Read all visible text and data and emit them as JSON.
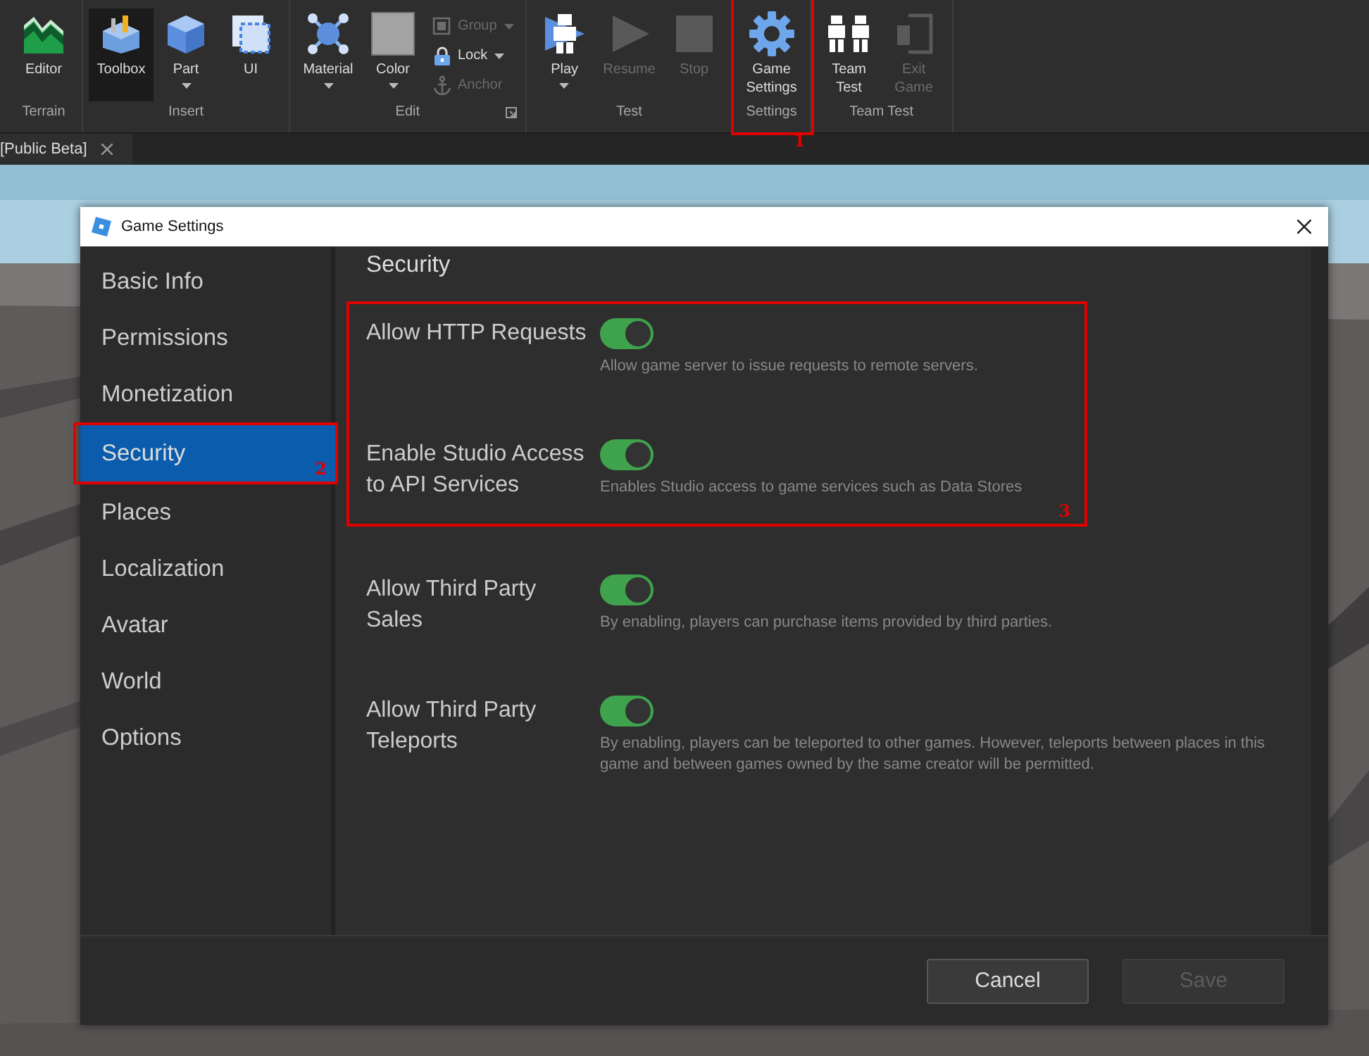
{
  "ribbon": {
    "groups": [
      {
        "label": "Terrain",
        "buttons": [
          {
            "kind": "large",
            "label": "Editor",
            "caret": false,
            "disabled": false,
            "selected": false
          }
        ]
      },
      {
        "label": "Insert",
        "buttons": [
          {
            "kind": "large",
            "label": "Toolbox",
            "caret": false,
            "disabled": false,
            "selected": true
          },
          {
            "kind": "large",
            "label": "Part",
            "caret": true,
            "disabled": false,
            "selected": false
          },
          {
            "kind": "large",
            "label": "UI",
            "caret": false,
            "disabled": false,
            "selected": false
          }
        ]
      },
      {
        "label": "Edit",
        "expander": true,
        "buttons": [
          {
            "kind": "large",
            "label": "Material",
            "caret": true,
            "disabled": false,
            "selected": false
          },
          {
            "kind": "large",
            "label": "Color",
            "caret": true,
            "disabled": false,
            "selected": false
          },
          {
            "kind": "small",
            "label": "Group",
            "caret": true,
            "disabled": true,
            "selected": false
          },
          {
            "kind": "small",
            "label": "Lock",
            "caret": true,
            "disabled": false,
            "selected": false
          },
          {
            "kind": "small",
            "label": "Anchor",
            "caret": false,
            "disabled": true,
            "selected": false
          }
        ]
      },
      {
        "label": "Test",
        "buttons": [
          {
            "kind": "large",
            "label": "Play",
            "caret": true,
            "disabled": false,
            "selected": false
          },
          {
            "kind": "large",
            "label": "Resume",
            "caret": false,
            "disabled": true,
            "selected": false
          },
          {
            "kind": "large",
            "label": "Stop",
            "caret": false,
            "disabled": true,
            "selected": false
          }
        ]
      },
      {
        "label": "Settings",
        "annotation": "1",
        "buttons": [
          {
            "kind": "large",
            "label": "Game Settings",
            "caret": false,
            "disabled": false,
            "selected": false
          }
        ]
      },
      {
        "label": "Team Test",
        "buttons": [
          {
            "kind": "large",
            "label": "Team Test",
            "caret": false,
            "disabled": false,
            "selected": false
          },
          {
            "kind": "large",
            "label": "Exit Game",
            "caret": false,
            "disabled": true,
            "selected": false
          }
        ]
      }
    ]
  },
  "document_tabs": [
    {
      "label": "[Public Beta]",
      "selected": true
    }
  ],
  "dialog": {
    "title": "Game Settings",
    "sidebar": {
      "items": [
        {
          "label": "Basic Info",
          "selected": false
        },
        {
          "label": "Permissions",
          "selected": false
        },
        {
          "label": "Monetization",
          "selected": false
        },
        {
          "label": "Security",
          "selected": true,
          "annotation": "2"
        },
        {
          "label": "Places",
          "selected": false
        },
        {
          "label": "Localization",
          "selected": false
        },
        {
          "label": "Avatar",
          "selected": false
        },
        {
          "label": "World",
          "selected": false
        },
        {
          "label": "Options",
          "selected": false
        }
      ]
    },
    "section_title": "Security",
    "setting_groups": [
      {
        "annotation": "3",
        "settings": [
          {
            "label": "Allow HTTP Requests",
            "on": true,
            "description": "Allow game server to issue requests to remote servers."
          },
          {
            "label": "Enable Studio Access to API Services",
            "on": true,
            "description": "Enables Studio access to game services such as Data Stores"
          }
        ]
      },
      {
        "settings": [
          {
            "label": "Allow Third Party Sales",
            "on": true,
            "description": "By enabling, players can purchase items provided by third parties."
          },
          {
            "label": "Allow Third Party Teleports",
            "on": true,
            "description": "By enabling, players can be teleported to other games. However, teleports between places in this game and between games owned by the same creator will be permitted."
          }
        ]
      }
    ],
    "buttons": [
      {
        "label": "Cancel",
        "disabled": false
      },
      {
        "label": "Save",
        "disabled": true
      }
    ]
  }
}
